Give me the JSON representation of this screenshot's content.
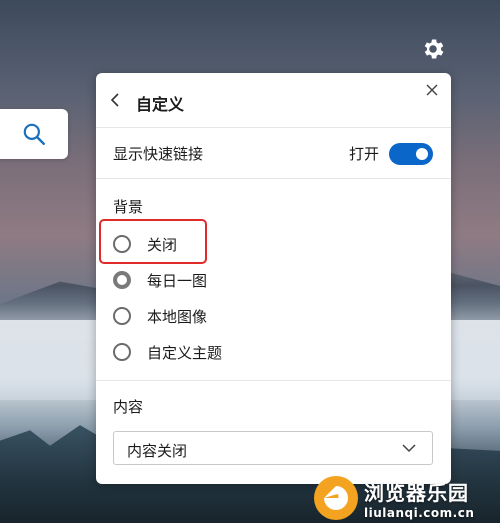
{
  "panel": {
    "title": "自定义",
    "quick_links": {
      "label": "显示快速链接",
      "state_label": "打开",
      "enabled": true
    },
    "background": {
      "title": "背景",
      "options": [
        {
          "label": "关闭",
          "selected": false
        },
        {
          "label": "每日一图",
          "selected": true
        },
        {
          "label": "本地图像",
          "selected": false
        },
        {
          "label": "自定义主题",
          "selected": false
        }
      ]
    },
    "content": {
      "title": "内容",
      "selected_value": "内容关闭"
    }
  },
  "icons": {
    "search": "search-icon",
    "settings": "gear-icon",
    "back": "chevron-left-icon",
    "close": "close-icon",
    "dropdown": "chevron-down-icon"
  },
  "colors": {
    "accent": "#0a66c8",
    "highlight": "#e02b2b"
  },
  "watermark": {
    "name": "浏览器乐园",
    "url": "liulanqi.com.cn"
  }
}
